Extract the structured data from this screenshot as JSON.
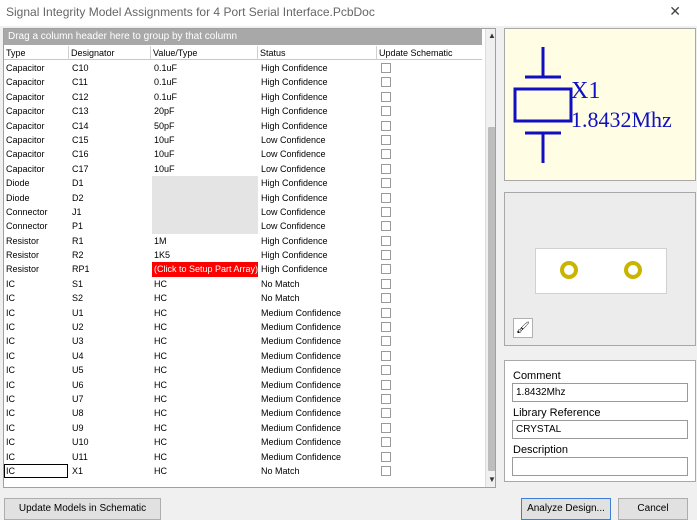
{
  "window": {
    "title": "Signal Integrity Model Assignments for 4 Port Serial Interface.PcbDoc",
    "close_glyph": "✕"
  },
  "grid": {
    "group_hint": "Drag a column header here to group by that column",
    "columns": [
      "Type",
      "Designator",
      "Value/Type",
      "Status",
      "Update Schematic"
    ],
    "rows": [
      {
        "type": "Capacitor",
        "designator": "C10",
        "value": "0.1uF",
        "status": "High Confidence"
      },
      {
        "type": "Capacitor",
        "designator": "C11",
        "value": "0.1uF",
        "status": "High Confidence"
      },
      {
        "type": "Capacitor",
        "designator": "C12",
        "value": "0.1uF",
        "status": "High Confidence"
      },
      {
        "type": "Capacitor",
        "designator": "C13",
        "value": "20pF",
        "status": "High Confidence"
      },
      {
        "type": "Capacitor",
        "designator": "C14",
        "value": "50pF",
        "status": "High Confidence"
      },
      {
        "type": "Capacitor",
        "designator": "C15",
        "value": "10uF",
        "status": "Low Confidence"
      },
      {
        "type": "Capacitor",
        "designator": "C16",
        "value": "10uF",
        "status": "Low Confidence"
      },
      {
        "type": "Capacitor",
        "designator": "C17",
        "value": "10uF",
        "status": "Low Confidence"
      },
      {
        "type": "Diode",
        "designator": "D1",
        "value": "",
        "status": "High Confidence"
      },
      {
        "type": "Diode",
        "designator": "D2",
        "value": "",
        "status": "High Confidence"
      },
      {
        "type": "Connector",
        "designator": "J1",
        "value": "",
        "status": "Low Confidence"
      },
      {
        "type": "Connector",
        "designator": "P1",
        "value": "",
        "status": "Low Confidence"
      },
      {
        "type": "Resistor",
        "designator": "R1",
        "value": "1M",
        "status": "High Confidence"
      },
      {
        "type": "Resistor",
        "designator": "R2",
        "value": "1K5",
        "status": "High Confidence"
      },
      {
        "type": "Resistor",
        "designator": "RP1",
        "value": "(Click to Setup Part Array)",
        "status": "High Confidence"
      },
      {
        "type": "IC",
        "designator": "S1",
        "value": "HC",
        "status": "No Match"
      },
      {
        "type": "IC",
        "designator": "S2",
        "value": "HC",
        "status": "No Match"
      },
      {
        "type": "IC",
        "designator": "U1",
        "value": "HC",
        "status": "Medium Confidence"
      },
      {
        "type": "IC",
        "designator": "U2",
        "value": "HC",
        "status": "Medium Confidence"
      },
      {
        "type": "IC",
        "designator": "U3",
        "value": "HC",
        "status": "Medium Confidence"
      },
      {
        "type": "IC",
        "designator": "U4",
        "value": "HC",
        "status": "Medium Confidence"
      },
      {
        "type": "IC",
        "designator": "U5",
        "value": "HC",
        "status": "Medium Confidence"
      },
      {
        "type": "IC",
        "designator": "U6",
        "value": "HC",
        "status": "Medium Confidence"
      },
      {
        "type": "IC",
        "designator": "U7",
        "value": "HC",
        "status": "Medium Confidence"
      },
      {
        "type": "IC",
        "designator": "U8",
        "value": "HC",
        "status": "Medium Confidence"
      },
      {
        "type": "IC",
        "designator": "U9",
        "value": "HC",
        "status": "Medium Confidence"
      },
      {
        "type": "IC",
        "designator": "U10",
        "value": "HC",
        "status": "Medium Confidence"
      },
      {
        "type": "IC",
        "designator": "U11",
        "value": "HC",
        "status": "Medium Confidence"
      },
      {
        "type": "IC",
        "designator": "X1",
        "value": "HC",
        "status": "No Match"
      }
    ]
  },
  "schematic_preview": {
    "designator": "X1",
    "value": "1.8432Mhz",
    "symbol_color": "#1010c0",
    "background": "#fffde3"
  },
  "pcb_preview": {
    "pad_color": "#c9b400",
    "button_icon": "paint-brush-icon"
  },
  "properties": {
    "comment_label": "Comment",
    "comment_value": "1.8432Mhz",
    "library_reference_label": "Library Reference",
    "library_reference_value": "CRYSTAL",
    "description_label": "Description",
    "description_value": ""
  },
  "buttons": {
    "update_models": "Update Models in Schematic",
    "analyze": "Analyze Design...",
    "cancel": "Cancel"
  },
  "colors": {
    "error_cell": "#ff0000",
    "group_bar": "#a8a8a8",
    "primary_border": "#3d7fd6"
  }
}
